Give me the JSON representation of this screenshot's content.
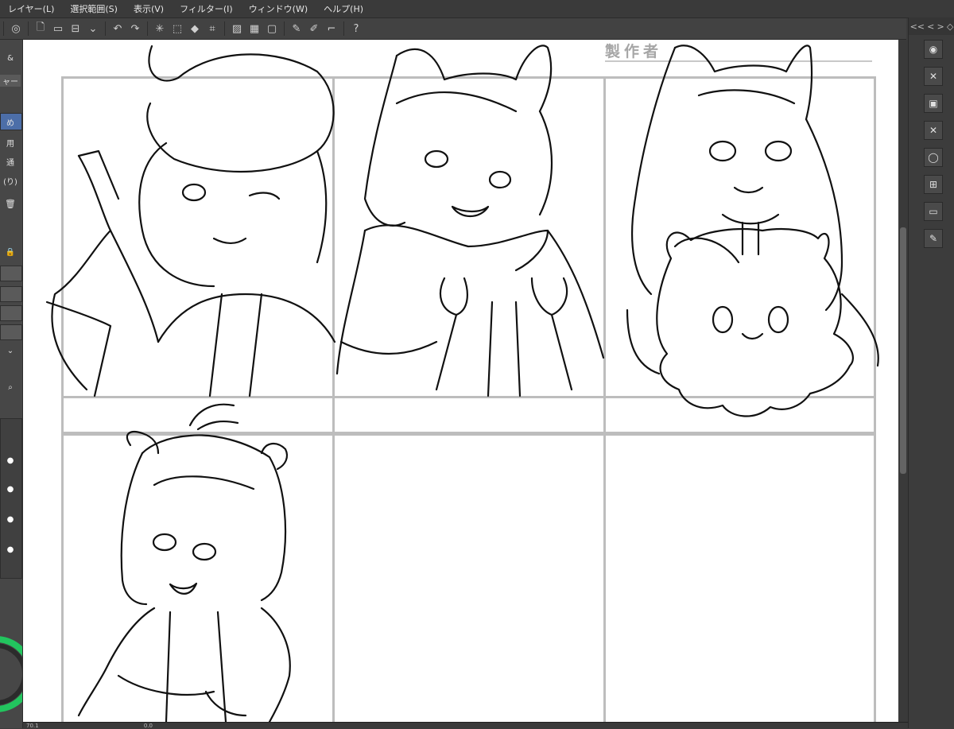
{
  "menu": [
    "レイヤー(L)",
    "選択範囲(S)",
    "表示(V)",
    "フィルター(I)",
    "ウィンドウ(W)",
    "ヘルプ(H)"
  ],
  "toolbar_icons": [
    "app-icon",
    "new-file-icon",
    "open-icon",
    "save-icon",
    "undo-icon",
    "redo-icon",
    "transform-icon",
    "select-icon",
    "fill-icon",
    "crop-icon",
    "ruler-icon",
    "grid-icon",
    "frame-icon",
    "pen-icon",
    "brush-icon",
    "eraser-icon",
    "help-icon"
  ],
  "left_panel_labels": [
    "&",
    "ャー",
    "め",
    "用",
    "通",
    "(り)"
  ],
  "canvas": {
    "header_text": "製作者"
  },
  "right_panel_header": [
    "<<",
    "<",
    ">",
    "◇"
  ],
  "right_panel_icons": [
    "navigator-icon",
    "close-icon",
    "layer-icon",
    "delete-icon",
    "comment-icon",
    "material-icon",
    "folder-icon",
    "edit-icon"
  ],
  "status": {
    "zoom": "70.1",
    "rotation": "0.0"
  },
  "colors": {
    "ui_dark": "#3c3c3c",
    "canvas": "#ffffff",
    "frame_border": "#bdbdbd",
    "wheel_outer": "#22c55e"
  }
}
